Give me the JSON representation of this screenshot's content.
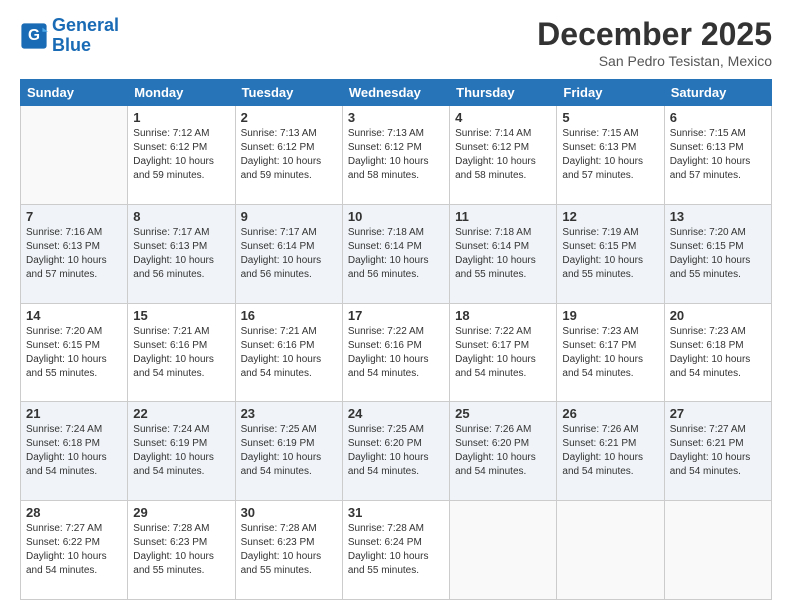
{
  "header": {
    "logo_line1": "General",
    "logo_line2": "Blue",
    "month": "December 2025",
    "location": "San Pedro Tesistan, Mexico"
  },
  "days_of_week": [
    "Sunday",
    "Monday",
    "Tuesday",
    "Wednesday",
    "Thursday",
    "Friday",
    "Saturday"
  ],
  "weeks": [
    [
      {
        "day": "",
        "info": ""
      },
      {
        "day": "1",
        "info": "Sunrise: 7:12 AM\nSunset: 6:12 PM\nDaylight: 10 hours\nand 59 minutes."
      },
      {
        "day": "2",
        "info": "Sunrise: 7:13 AM\nSunset: 6:12 PM\nDaylight: 10 hours\nand 59 minutes."
      },
      {
        "day": "3",
        "info": "Sunrise: 7:13 AM\nSunset: 6:12 PM\nDaylight: 10 hours\nand 58 minutes."
      },
      {
        "day": "4",
        "info": "Sunrise: 7:14 AM\nSunset: 6:12 PM\nDaylight: 10 hours\nand 58 minutes."
      },
      {
        "day": "5",
        "info": "Sunrise: 7:15 AM\nSunset: 6:13 PM\nDaylight: 10 hours\nand 57 minutes."
      },
      {
        "day": "6",
        "info": "Sunrise: 7:15 AM\nSunset: 6:13 PM\nDaylight: 10 hours\nand 57 minutes."
      }
    ],
    [
      {
        "day": "7",
        "info": "Sunrise: 7:16 AM\nSunset: 6:13 PM\nDaylight: 10 hours\nand 57 minutes."
      },
      {
        "day": "8",
        "info": "Sunrise: 7:17 AM\nSunset: 6:13 PM\nDaylight: 10 hours\nand 56 minutes."
      },
      {
        "day": "9",
        "info": "Sunrise: 7:17 AM\nSunset: 6:14 PM\nDaylight: 10 hours\nand 56 minutes."
      },
      {
        "day": "10",
        "info": "Sunrise: 7:18 AM\nSunset: 6:14 PM\nDaylight: 10 hours\nand 56 minutes."
      },
      {
        "day": "11",
        "info": "Sunrise: 7:18 AM\nSunset: 6:14 PM\nDaylight: 10 hours\nand 55 minutes."
      },
      {
        "day": "12",
        "info": "Sunrise: 7:19 AM\nSunset: 6:15 PM\nDaylight: 10 hours\nand 55 minutes."
      },
      {
        "day": "13",
        "info": "Sunrise: 7:20 AM\nSunset: 6:15 PM\nDaylight: 10 hours\nand 55 minutes."
      }
    ],
    [
      {
        "day": "14",
        "info": "Sunrise: 7:20 AM\nSunset: 6:15 PM\nDaylight: 10 hours\nand 55 minutes."
      },
      {
        "day": "15",
        "info": "Sunrise: 7:21 AM\nSunset: 6:16 PM\nDaylight: 10 hours\nand 54 minutes."
      },
      {
        "day": "16",
        "info": "Sunrise: 7:21 AM\nSunset: 6:16 PM\nDaylight: 10 hours\nand 54 minutes."
      },
      {
        "day": "17",
        "info": "Sunrise: 7:22 AM\nSunset: 6:16 PM\nDaylight: 10 hours\nand 54 minutes."
      },
      {
        "day": "18",
        "info": "Sunrise: 7:22 AM\nSunset: 6:17 PM\nDaylight: 10 hours\nand 54 minutes."
      },
      {
        "day": "19",
        "info": "Sunrise: 7:23 AM\nSunset: 6:17 PM\nDaylight: 10 hours\nand 54 minutes."
      },
      {
        "day": "20",
        "info": "Sunrise: 7:23 AM\nSunset: 6:18 PM\nDaylight: 10 hours\nand 54 minutes."
      }
    ],
    [
      {
        "day": "21",
        "info": "Sunrise: 7:24 AM\nSunset: 6:18 PM\nDaylight: 10 hours\nand 54 minutes."
      },
      {
        "day": "22",
        "info": "Sunrise: 7:24 AM\nSunset: 6:19 PM\nDaylight: 10 hours\nand 54 minutes."
      },
      {
        "day": "23",
        "info": "Sunrise: 7:25 AM\nSunset: 6:19 PM\nDaylight: 10 hours\nand 54 minutes."
      },
      {
        "day": "24",
        "info": "Sunrise: 7:25 AM\nSunset: 6:20 PM\nDaylight: 10 hours\nand 54 minutes."
      },
      {
        "day": "25",
        "info": "Sunrise: 7:26 AM\nSunset: 6:20 PM\nDaylight: 10 hours\nand 54 minutes."
      },
      {
        "day": "26",
        "info": "Sunrise: 7:26 AM\nSunset: 6:21 PM\nDaylight: 10 hours\nand 54 minutes."
      },
      {
        "day": "27",
        "info": "Sunrise: 7:27 AM\nSunset: 6:21 PM\nDaylight: 10 hours\nand 54 minutes."
      }
    ],
    [
      {
        "day": "28",
        "info": "Sunrise: 7:27 AM\nSunset: 6:22 PM\nDaylight: 10 hours\nand 54 minutes."
      },
      {
        "day": "29",
        "info": "Sunrise: 7:28 AM\nSunset: 6:23 PM\nDaylight: 10 hours\nand 55 minutes."
      },
      {
        "day": "30",
        "info": "Sunrise: 7:28 AM\nSunset: 6:23 PM\nDaylight: 10 hours\nand 55 minutes."
      },
      {
        "day": "31",
        "info": "Sunrise: 7:28 AM\nSunset: 6:24 PM\nDaylight: 10 hours\nand 55 minutes."
      },
      {
        "day": "",
        "info": ""
      },
      {
        "day": "",
        "info": ""
      },
      {
        "day": "",
        "info": ""
      }
    ]
  ]
}
